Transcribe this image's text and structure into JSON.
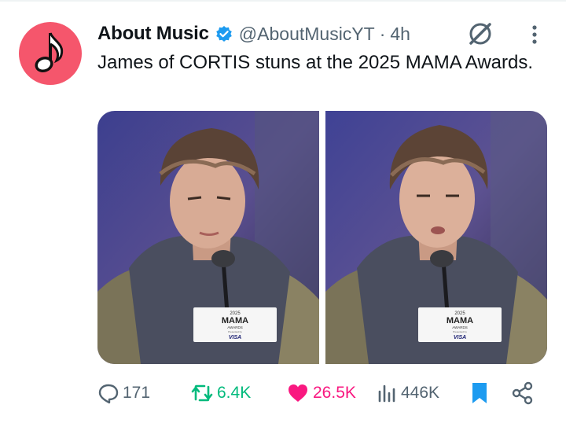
{
  "post": {
    "author_name": "About Music",
    "handle": "@AboutMusicYT",
    "separator": "·",
    "time": "4h",
    "text": "James of CORTIS stuns at the 2025 MAMA Awards."
  },
  "media": {
    "photos": [
      {
        "placard_year": "2025",
        "placard_logo": "MAMA",
        "placard_sub": "AWARDS",
        "placard_tiny": "Presented by",
        "placard_sponsor": "VISA"
      },
      {
        "placard_year": "2025",
        "placard_logo": "MAMA",
        "placard_sub": "AWARDS",
        "placard_tiny": "Presented by",
        "placard_sponsor": "VISA"
      }
    ]
  },
  "actions": {
    "replies": "171",
    "reposts": "6.4K",
    "likes": "26.5K",
    "views": "446K"
  },
  "colors": {
    "avatar_bg": "#f5566c",
    "verified": "#1d9bf0",
    "repost": "#00ba7c",
    "like": "#f91880",
    "bookmark": "#1d9bf0",
    "muted": "#536471"
  },
  "icons": [
    "music-note-icon",
    "verified-badge-icon",
    "grok-icon",
    "more-icon",
    "reply-icon",
    "repost-icon",
    "like-icon",
    "views-icon",
    "bookmark-icon",
    "share-icon"
  ]
}
